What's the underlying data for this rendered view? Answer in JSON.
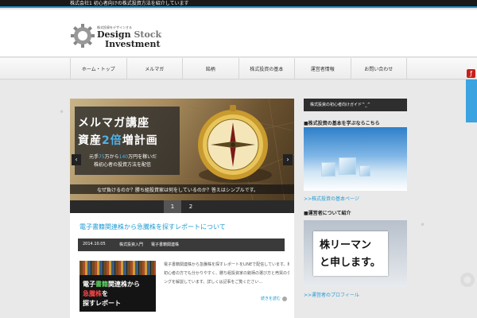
{
  "topbar": {
    "text": "株式会社1 初心者向けの株式投資方法を紹介しています"
  },
  "logo": {
    "small_text": "株式投資をデザインする",
    "line1_main": "Design",
    "line1_accent": "Stock",
    "line2": "Investment"
  },
  "nav": {
    "items": [
      {
        "label": "ホーム・トップ"
      },
      {
        "label": "メルマガ"
      },
      {
        "label": "銘柄"
      },
      {
        "label": "株式投資の基本"
      },
      {
        "label": "運営者情報"
      },
      {
        "label": "お問い合わせ"
      }
    ]
  },
  "slider": {
    "title_line1": "メルマガ講座",
    "title_line2_pre": "資産",
    "title_line2_hl": "2倍",
    "title_line2_post": "増計画",
    "body_line1_pre": "元手",
    "body_line1_hl1": "75",
    "body_line1_mid": "万から",
    "body_line1_hl2": "140",
    "body_line1_post": "万円を稼いだ",
    "body_line2": "株初心者の投資方法を配信",
    "caption": "なぜ負けるのか？勝ち組投資家は何をしているのか？答えはシンプルです。",
    "prev_label": "‹",
    "next_label": "›",
    "pages": [
      "1",
      "2"
    ],
    "active_page": 1
  },
  "post": {
    "title": "電子書籍関連株から急騰株を探すレポートについて",
    "date": "2014.10.05",
    "category": "株式投資入門",
    "tag": "電子書籍関連株",
    "thumb_line1_pre": "電子",
    "thumb_line1_hl": "書籍",
    "thumb_line1_post": "関連株から",
    "thumb_line2_hl": "急騰株",
    "thumb_line2_post": "を",
    "thumb_line3": "探すレポート",
    "excerpt_lines": [
      "電子書籍関連株から急騰株を探すレポートをLINEで配信しています。株式投資",
      "初心者の方でも分かりやすく、勝ち組投資家の銘柄の選び方と売買のタイミ",
      "ングを解説しています。詳しくは記事をご覧ください…"
    ],
    "read_more": "続きを読む"
  },
  "sidebar": {
    "header": "株式投資の初心者向けガイド^_^",
    "section1_title": "■株式投資の基本を学ぶならこちら",
    "section1_link": ">>株式投資の基本ページ",
    "section2_title": "■運営者について紹介",
    "sign_line1": "株リーマン",
    "sign_line2": "と申します。",
    "section2_link": ">>運営者のプロフィール"
  },
  "colors": {
    "accent": "#1e9bd4",
    "topbar": "#1a1a1a",
    "dark_bar": "#2e2e2e",
    "flash": "#c8201c"
  },
  "icons": {
    "logo": "gear-icon",
    "flash": "flash-icon",
    "read_more": "circle-arrow-icon",
    "corner": "gear-icon"
  }
}
